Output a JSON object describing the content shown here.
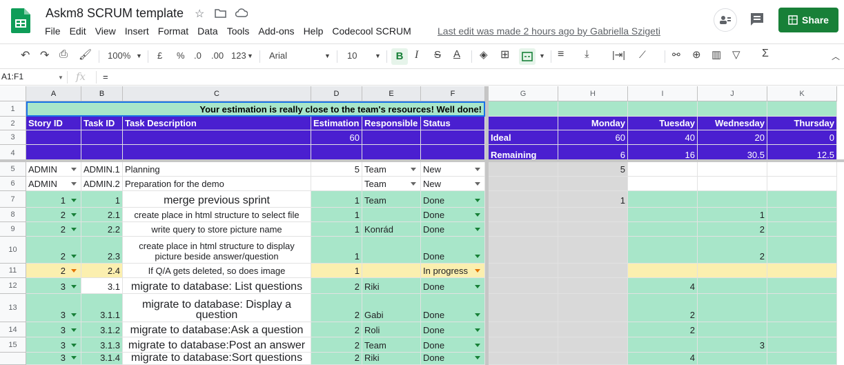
{
  "doc": {
    "title": "Askm8 SCRUM template"
  },
  "menu": [
    "File",
    "Edit",
    "View",
    "Insert",
    "Format",
    "Data",
    "Tools",
    "Add-ons",
    "Help",
    "Codecool SCRUM"
  ],
  "last_edit": "Last edit was made 2 hours ago by Gabriella Szigeti",
  "share_label": "Share",
  "toolbar": {
    "zoom": "100%",
    "currency": "£",
    "percent": "%",
    "dec_less": ".0",
    "dec_more": ".00",
    "format_more": "123",
    "font": "Arial",
    "size": "10",
    "bold": "B",
    "italic": "I",
    "strike": "S",
    "textcolor": "A"
  },
  "formula": {
    "namebox": "A1:F1",
    "fx": "fx",
    "value": "="
  },
  "columns": [
    "A",
    "B",
    "C",
    "D",
    "E",
    "F",
    "G",
    "H",
    "I",
    "J",
    "K"
  ],
  "rows_labels": [
    "1",
    "2",
    "3",
    "4",
    "5",
    "6",
    "7",
    "8",
    "9",
    "10",
    "11",
    "12",
    "13",
    "14",
    "15",
    ""
  ],
  "banner": "Your estimation is really close to the team's resources! Well done!",
  "headers": {
    "story": "Story ID",
    "task": "Task ID",
    "desc": "Task Description",
    "est": "Estimation",
    "resp": "Responsible",
    "status": "Status",
    "mon": "Monday",
    "tue": "Tuesday",
    "wed": "Wednesday",
    "thu": "Thursday"
  },
  "summary": {
    "total": "60",
    "ideal_label": "Ideal",
    "ideal": [
      "60",
      "40",
      "20",
      "0"
    ],
    "remaining_label": "Remaining",
    "remaining": [
      "6",
      "16",
      "30.5",
      "12.5"
    ]
  },
  "tasks": [
    {
      "story": "ADMIN",
      "task": "ADMIN.1",
      "desc": "Planning",
      "est": "5",
      "resp": "Team",
      "status": "New",
      "h": "5",
      "i": "",
      "j": "",
      "k": ""
    },
    {
      "story": "ADMIN",
      "task": "ADMIN.2",
      "desc": "Preparation for the demo",
      "est": "",
      "resp": "Team",
      "status": "New",
      "h": "",
      "i": "",
      "j": "",
      "k": ""
    },
    {
      "story": "1",
      "task": "1",
      "desc": "merge previous sprint",
      "est": "1",
      "resp": "Team",
      "status": "Done",
      "h": "1",
      "i": "",
      "j": "",
      "k": ""
    },
    {
      "story": "2",
      "task": "2.1",
      "desc": "create place in html structure to select file",
      "est": "1",
      "resp": "",
      "status": "Done",
      "h": "",
      "i": "",
      "j": "1",
      "k": ""
    },
    {
      "story": "2",
      "task": "2.2",
      "desc": "write query to store picture name",
      "est": "1",
      "resp": "Konrád",
      "status": "Done",
      "h": "",
      "i": "",
      "j": "2",
      "k": ""
    },
    {
      "story": "2",
      "task": "2.3",
      "desc": "create place in html structure to display picture beside answer/question",
      "est": "1",
      "resp": "",
      "status": "Done",
      "h": "",
      "i": "",
      "j": "2",
      "k": ""
    },
    {
      "story": "2",
      "task": "2.4",
      "desc": "If Q/A gets deleted, so does image",
      "est": "1",
      "resp": "",
      "status": "In progress",
      "h": "",
      "i": "",
      "j": "",
      "k": ""
    },
    {
      "story": "3",
      "task": "3.1",
      "desc": "migrate to database: List questions",
      "est": "2",
      "resp": "Riki",
      "status": "Done",
      "h": "",
      "i": "4",
      "j": "",
      "k": ""
    },
    {
      "story": "3",
      "task": "3.1.1",
      "desc": "migrate to database: Display a question",
      "est": "2",
      "resp": "Gabi",
      "status": "Done",
      "h": "",
      "i": "2",
      "j": "",
      "k": ""
    },
    {
      "story": "3",
      "task": "3.1.2",
      "desc": "migrate to database:Ask a question",
      "est": "2",
      "resp": "Roli",
      "status": "Done",
      "h": "",
      "i": "2",
      "j": "",
      "k": ""
    },
    {
      "story": "3",
      "task": "3.1.3",
      "desc": "migrate to database:Post an answer",
      "est": "2",
      "resp": "Team",
      "status": "Done",
      "h": "",
      "i": "",
      "j": "3",
      "k": ""
    },
    {
      "story": "3",
      "task": "3.1.4",
      "desc": "migrate to database:Sort questions",
      "est": "2",
      "resp": "Riki",
      "status": "Done",
      "h": "",
      "i": "4",
      "j": "",
      "k": ""
    }
  ],
  "colors": {
    "purple": "#4a1fd0",
    "green": "#a8e6c9",
    "yellow": "#fbefaf",
    "grey": "#d9d9d9",
    "share": "#188038"
  }
}
